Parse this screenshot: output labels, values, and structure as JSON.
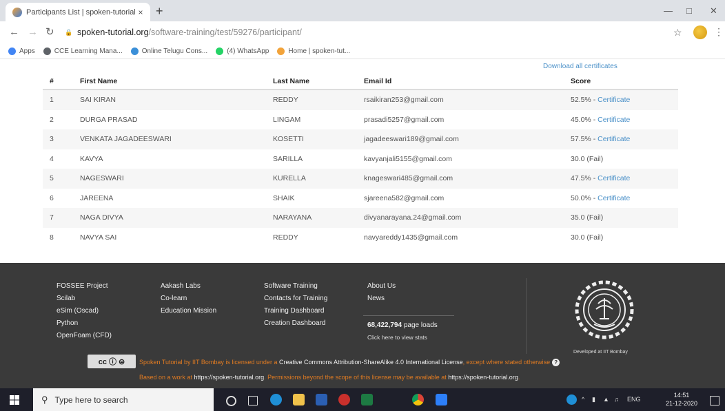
{
  "browser": {
    "tab_title": "Participants List | spoken-tutorial",
    "tab_close": "×",
    "new_tab": "+",
    "url_host": "spoken-tutorial.org",
    "url_path": "/software-training/test/59276/participant/",
    "bookmarks": [
      {
        "label": "Apps",
        "color": "#4285f4"
      },
      {
        "label": "CCE Learning Mana...",
        "color": "#5f6368"
      },
      {
        "label": "Online Telugu Cons...",
        "color": "#3b8fd8"
      },
      {
        "label": "(4) WhatsApp",
        "color": "#25d366"
      },
      {
        "label": "Home | spoken-tut...",
        "color": "#f2a33a"
      }
    ]
  },
  "page": {
    "download_link": "Download all certificates",
    "columns": [
      "#",
      "First Name",
      "Last Name",
      "Email Id",
      "Score"
    ],
    "rows": [
      {
        "n": "1",
        "first": "SAI KIRAN",
        "last": "REDDY",
        "email": "rsaikiran253@gmail.com",
        "score": "52.5% - ",
        "cert": "Certificate"
      },
      {
        "n": "2",
        "first": "DURGA PRASAD",
        "last": "LINGAM",
        "email": "prasadi5257@gmail.com",
        "score": "45.0% - ",
        "cert": "Certificate"
      },
      {
        "n": "3",
        "first": "VENKATA JAGADEESWARI",
        "last": "KOSETTI",
        "email": "jagadeeswari189@gmail.com",
        "score": "57.5% - ",
        "cert": "Certificate"
      },
      {
        "n": "4",
        "first": "KAVYA",
        "last": "SARILLA",
        "email": "kavyanjali5155@gmail.com",
        "score": "30.0 (Fail)",
        "cert": ""
      },
      {
        "n": "5",
        "first": "NAGESWARI",
        "last": "KURELLA",
        "email": "knageswari485@gmail.com",
        "score": "47.5% - ",
        "cert": "Certificate"
      },
      {
        "n": "6",
        "first": "JAREENA",
        "last": "SHAIK",
        "email": "sjareena582@gmail.com",
        "score": "50.0% - ",
        "cert": "Certificate"
      },
      {
        "n": "7",
        "first": "NAGA DIVYA",
        "last": "NARAYANA",
        "email": "divyanarayana.24@gmail.com",
        "score": "35.0 (Fail)",
        "cert": ""
      },
      {
        "n": "8",
        "first": "NAVYA SAI",
        "last": "REDDY",
        "email": "navyareddy1435@gmail.com",
        "score": "30.0 (Fail)",
        "cert": ""
      }
    ]
  },
  "footer": {
    "col1": [
      "FOSSEE Project",
      "Scilab",
      "eSim (Oscad)",
      "Python",
      "OpenFoam (CFD)"
    ],
    "col2": [
      "Aakash Labs",
      "Co-learn",
      "Education Mission"
    ],
    "col3": [
      "Software Training",
      "Contacts for Training",
      "Training Dashboard",
      "Creation Dashboard"
    ],
    "col4": [
      "About Us",
      "News"
    ],
    "page_loads_count": "68,422,794",
    "page_loads_label": " page loads",
    "stats_link": "Click here to view stats",
    "developed_by": "Developed at IIT Bombay",
    "cc_badge": "cc ⓘ ⊜",
    "license_a": "Spoken Tutorial by IIT Bombay is licensed under a ",
    "license_b": "Creative Commons Attribution-ShareAlike 4.0 International License",
    "license_c": ", except where stated otherwise",
    "based_a": "Based on a work at ",
    "based_b": "https://spoken-tutorial.org",
    "based_c": ". Permissions beyond the scope of this license may be available at ",
    "based_d": "https://spoken-tutorial.org",
    "based_e": "."
  },
  "taskbar": {
    "search_placeholder": "Type here to search",
    "lang": "ENG",
    "time": "14:51",
    "date": "21-12-2020"
  }
}
